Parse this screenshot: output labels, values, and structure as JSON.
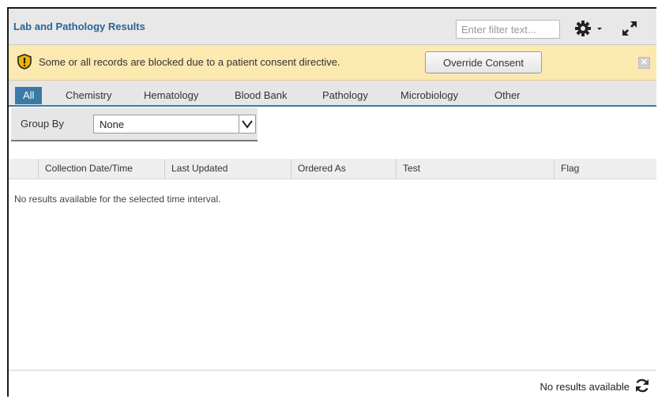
{
  "header": {
    "title": "Lab and Pathology Results",
    "filter_placeholder": "Enter filter text...",
    "settings_icon": "gear-icon",
    "expand_icon": "expand-icon"
  },
  "consent": {
    "message": "Some or all records are blocked due to a patient consent directive.",
    "override_label": "Override Consent",
    "warning_icon": "shield-warning-icon",
    "close_icon": "close-icon"
  },
  "tabs": [
    {
      "label": "All",
      "active": true
    },
    {
      "label": "Chemistry"
    },
    {
      "label": "Hematology"
    },
    {
      "label": "Blood Bank"
    },
    {
      "label": "Pathology"
    },
    {
      "label": "Microbiology"
    },
    {
      "label": "Other"
    }
  ],
  "group_by": {
    "label": "Group By",
    "value": "None"
  },
  "columns": [
    "Collection Date/Time",
    "Last Updated",
    "Ordered As",
    "Test",
    "Flag"
  ],
  "empty_message": "No results available for the selected time interval.",
  "footer": {
    "status": "No results available",
    "refresh_icon": "refresh-icon"
  },
  "colors": {
    "title_blue": "#2a6496",
    "tab_active": "#3b7aa6",
    "consent_bg": "#fbe9b0"
  }
}
